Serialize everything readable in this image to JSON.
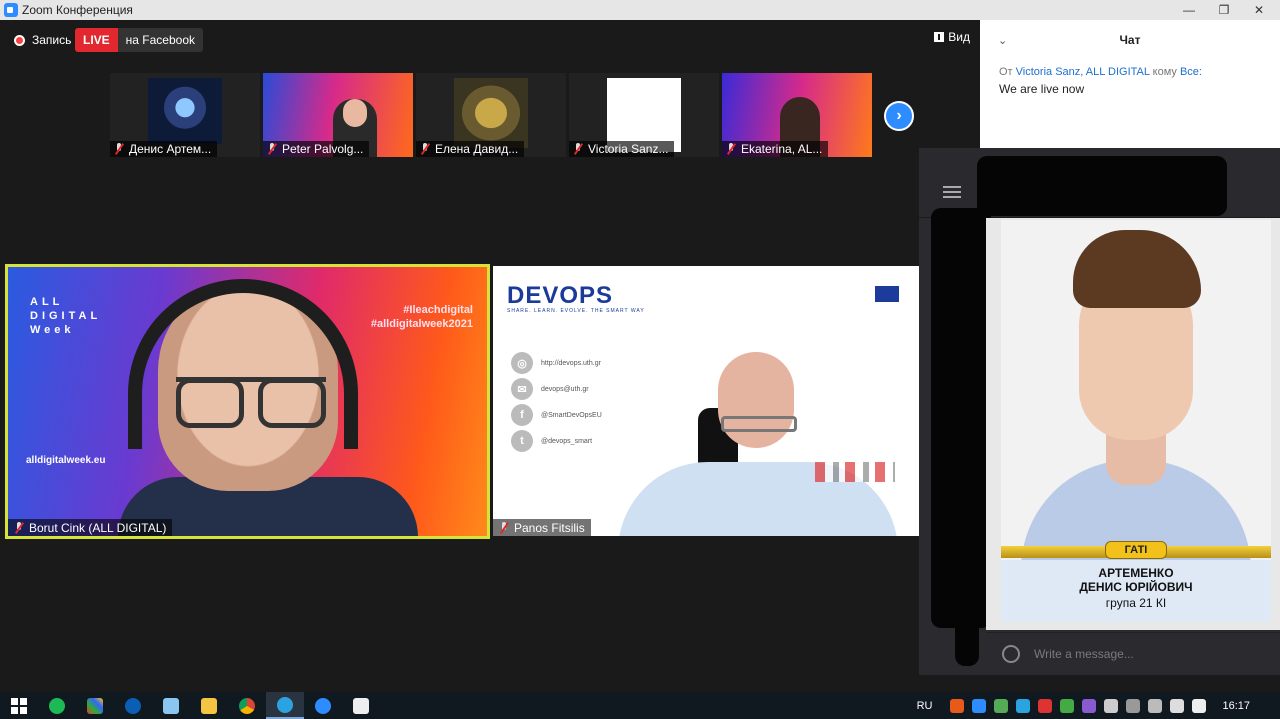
{
  "window": {
    "title": "Zoom Конференция"
  },
  "toolbar": {
    "recording_label": "Запись",
    "live_label": "LIVE",
    "stream_label": "на Facebook",
    "view_label": "Вид"
  },
  "thumbnails": [
    {
      "name": "Денис Артем..."
    },
    {
      "name": "Peter Palvolg..."
    },
    {
      "name": "Елена Давид..."
    },
    {
      "name": "Victoria Sanz..."
    },
    {
      "name": "Ekaterina, AL..."
    }
  ],
  "main_videos": [
    {
      "name": "Borut Cink (ALL DIGITAL)",
      "brand_lines": [
        "ALL",
        "DIGITAL",
        "Week"
      ],
      "hashtags": [
        "#Ileachdigital",
        "#alldigitalweek2021"
      ],
      "site": "alldigitalweek.eu"
    },
    {
      "name": "Panos Fitsilis",
      "logo": "DEVOPS",
      "logo_sub": "SHARE. LEARN. EVOLVE. THE SMART WAY",
      "contacts": [
        "http://devops.uth.gr",
        "devops@uth.gr",
        "@SmartDevOpsEU",
        "@devops_smart"
      ]
    }
  ],
  "chat": {
    "title": "Чат",
    "from_prefix": "От",
    "sender": "Victoria Sanz, ALL DIGITAL",
    "to_word": "кому",
    "recipient": "Все:",
    "message": "We are live now"
  },
  "overlay": {
    "badge": "ГАТІ",
    "name_line1": "АРТЕМЕНКО",
    "name_line2": "ДЕНИС ЮРІЙОВИЧ",
    "group": "група 21 КІ",
    "input_placeholder": "Write a message..."
  },
  "taskbar": {
    "language": "RU",
    "time": "16:17"
  },
  "colors": {
    "live_red": "#e0282e",
    "zoom_blue": "#2d8cff",
    "active_speaker_border": "#d6e43a"
  }
}
